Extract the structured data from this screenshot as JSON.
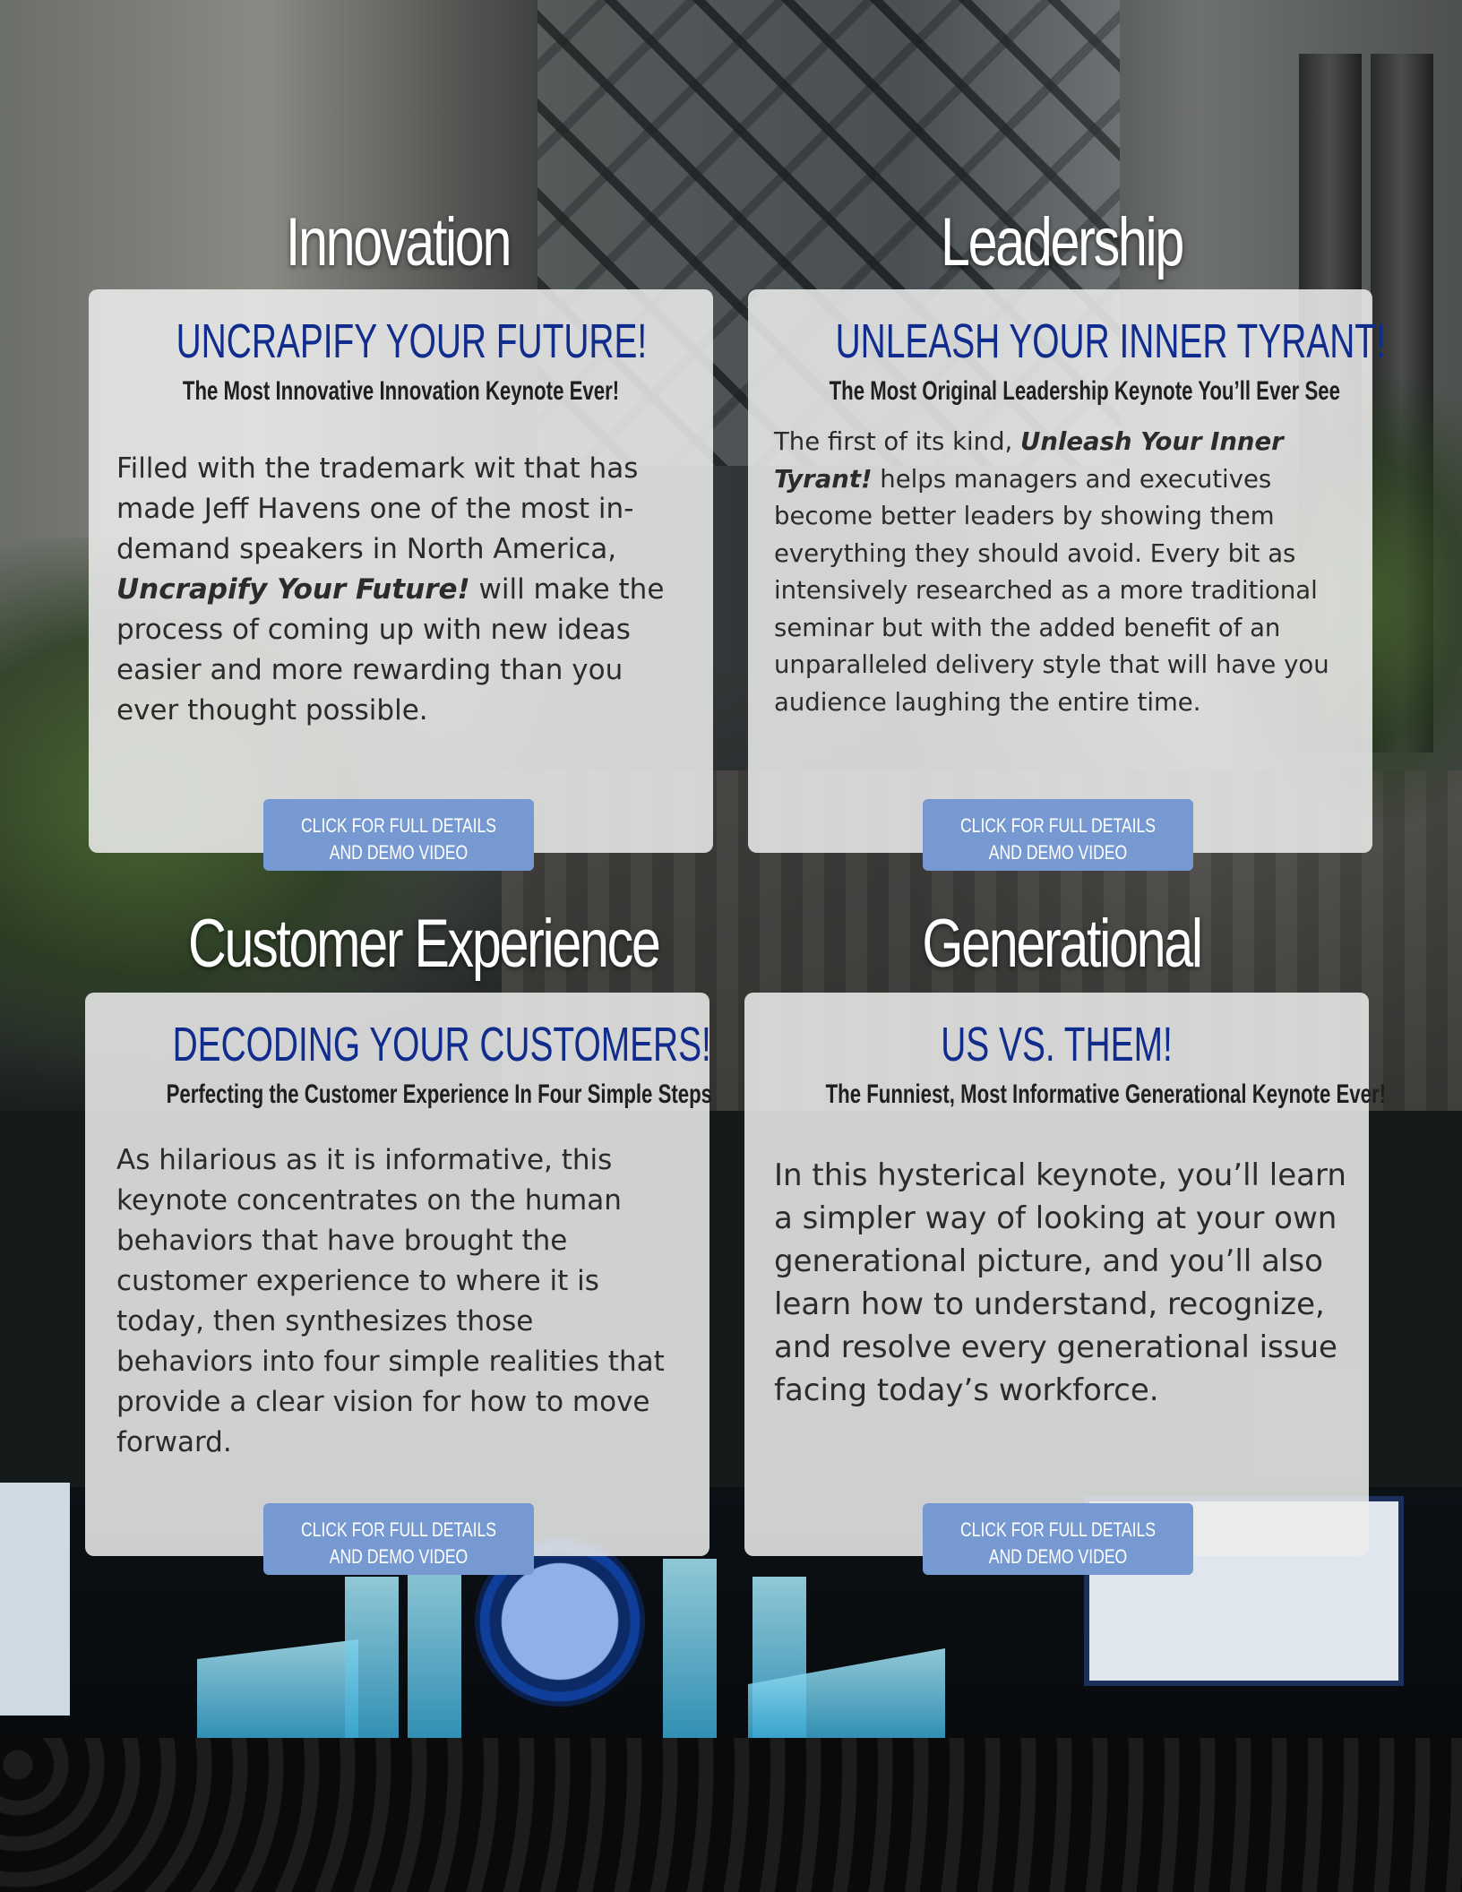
{
  "colors": {
    "title_blue": "#102c8c",
    "button_blue": "#7699d2",
    "card_background": "#ececec",
    "heading_white": "#ffffff"
  },
  "sections": [
    {
      "heading": "Innovation",
      "title": "UNCRAPIFY YOUR FUTURE!",
      "subtitle": "The Most Innovative Innovation Keynote Ever!",
      "body_before": "Filled with the trademark wit that has made Jeff Havens one of the most in-demand speakers in North America, ",
      "body_emphasis": "Uncrapify Your Future!",
      "body_after": " will make the process of coming up with new ideas easier and more rewarding than you ever thought possible.",
      "button_line1": "CLICK FOR FULL DETAILS",
      "button_line2": "AND DEMO VIDEO"
    },
    {
      "heading": "Leadership",
      "title": "UNLEASH YOUR INNER TYRANT!",
      "subtitle": "The Most Original Leadership Keynote You’ll Ever See",
      "body_before": "The first of its kind, ",
      "body_emphasis": "Unleash Your Inner Tyrant!",
      "body_after": " helps managers and executives become better leaders by showing them everything they should avoid.  Every bit as intensively researched as a more traditional seminar but with the added benefit of an unparalleled delivery style that will have you audience laughing the entire time.",
      "button_line1": "CLICK FOR FULL DETAILS",
      "button_line2": "AND DEMO VIDEO"
    },
    {
      "heading": "Customer Experience",
      "title": "DECODING YOUR CUSTOMERS!",
      "subtitle": "Perfecting the Customer Experience In Four Simple Steps",
      "body_before": "As hilarious as it is informative, this keynote concentrates on the human behaviors that have brought the customer experience to where it is today, then synthesizes those behaviors into four simple realities that provide a clear vision for how to move forward.",
      "button_line1": "CLICK FOR FULL DETAILS",
      "button_line2": "AND DEMO VIDEO"
    },
    {
      "heading": "Generational",
      "title": "US VS. THEM!",
      "subtitle": "The Funniest, Most Informative Generational Keynote Ever!",
      "body_before": "In this hysterical keynote, you’ll learn a simpler way of looking at your own generational picture, and you’ll also learn how to understand, recognize, and resolve every generational issue facing today’s workforce.",
      "button_line1": "CLICK FOR FULL DETAILS",
      "button_line2": "AND DEMO VIDEO"
    }
  ]
}
